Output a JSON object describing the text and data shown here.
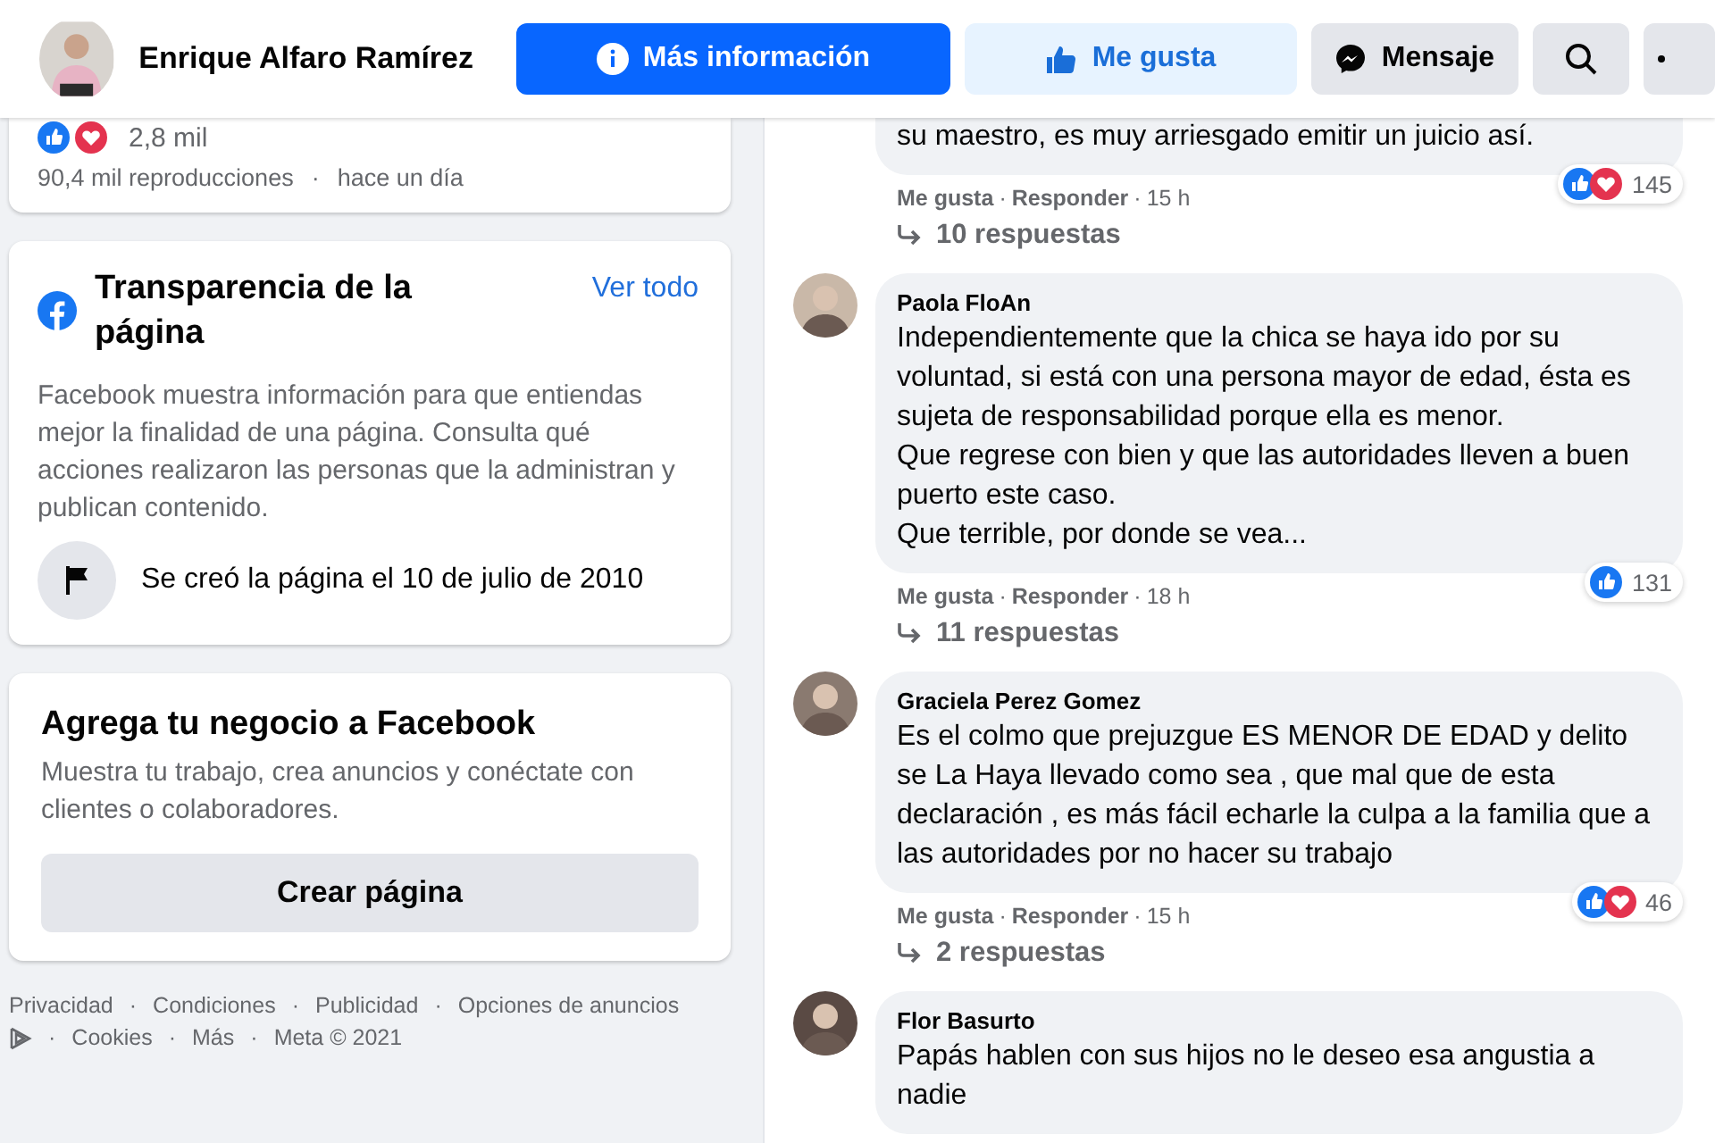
{
  "page_header": {
    "name": "Enrique Alfaro Ramírez",
    "buttons": [
      {
        "kind": "primary",
        "label": "Más información"
      },
      {
        "kind": "like",
        "label": "Me gusta"
      },
      {
        "kind": "message",
        "label": "Mensaje"
      },
      {
        "kind": "search"
      },
      {
        "kind": "more"
      }
    ]
  },
  "separator": "·",
  "post_summary": {
    "reaction_icons": [
      {
        "kind": "like"
      },
      {
        "kind": "love"
      }
    ],
    "reaction_count": "2,8 mil",
    "views": "90,4 mil reproducciones",
    "time": "hace un día"
  },
  "transparency": {
    "title": "Transparencia de la página",
    "link": "Ver todo",
    "description": "Facebook muestra información para que entiendas mejor la finalidad de una página. Consulta qué acciones realizaron las personas que la administran y publican contenido.",
    "created": "Se creó la página el 10 de julio de 2010"
  },
  "business": {
    "title": "Agrega tu negocio a Facebook",
    "description": "Muestra tu trabajo, crea anuncios y conéctate con clientes o colaboradores.",
    "button": "Crear página"
  },
  "footer": {
    "links": [
      "Privacidad",
      "Condiciones",
      "Publicidad",
      "Opciones de anuncios"
    ],
    "links_after_icon": [
      "Cookies",
      "Más",
      "Meta © 2021"
    ]
  },
  "comments": [
    {
      "text": "su maestro, es muy arriesgado emitir un juicio así.",
      "actions": [
        "Me gusta",
        "Responder"
      ],
      "time": "15 h",
      "reaction_icons": [
        {
          "kind": "like"
        },
        {
          "kind": "love"
        }
      ],
      "reaction_count": "145",
      "replies": "10 respuestas"
    },
    {
      "author": "Paola FloAn",
      "lines": [
        "Independientemente que la chica se haya ido por su voluntad, si está con una persona mayor de edad, ésta es sujeta de responsabilidad porque ella es menor.",
        "Que regrese con bien y que las autoridades lleven a buen puerto este caso.",
        "Que terrible, por donde se vea..."
      ],
      "actions": [
        "Me gusta",
        "Responder"
      ],
      "time": "18 h",
      "reaction_icons": [
        {
          "kind": "like"
        }
      ],
      "reaction_count": "131",
      "replies": "11 respuestas"
    },
    {
      "author": "Graciela Perez Gomez",
      "lines": [
        "Es el colmo que prejuzgue ES MENOR DE EDAD y delito se La Haya llevado como sea , que mal que de esta declaración , es más fácil echarle la culpa a la familia que a las autoridades por no hacer su trabajo"
      ],
      "actions": [
        "Me gusta",
        "Responder"
      ],
      "time": "15 h",
      "reaction_icons": [
        {
          "kind": "like"
        },
        {
          "kind": "love"
        }
      ],
      "reaction_count": "46",
      "replies": "2 respuestas"
    },
    {
      "author": "Flor Basurto",
      "lines": [
        "Papás hablen con sus hijos no le deseo esa angustia a nadie"
      ]
    }
  ]
}
